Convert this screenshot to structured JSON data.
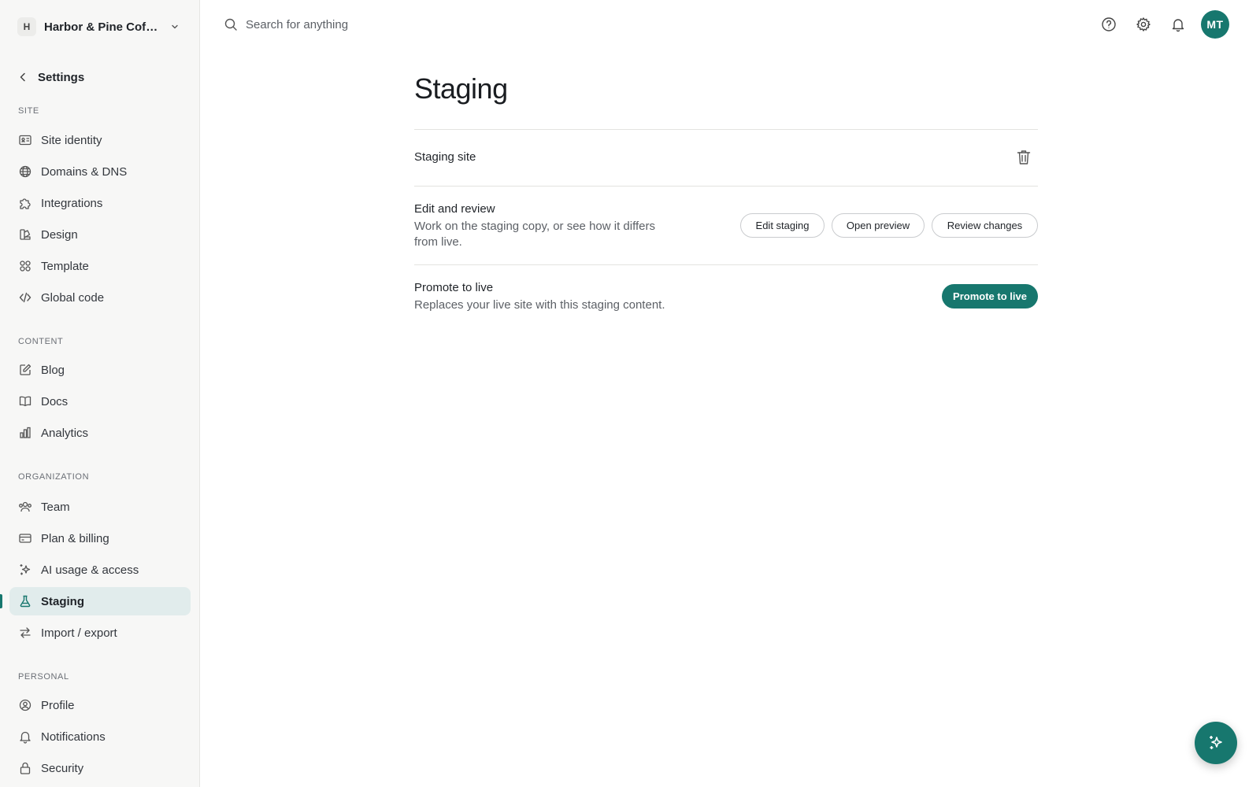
{
  "workspace": {
    "initial": "H",
    "name": "Harbor & Pine Coff…"
  },
  "sidebar": {
    "back_label": "Settings",
    "sections": [
      {
        "label": "SITE",
        "items": [
          {
            "label": "Site identity",
            "icon": "id-card-icon"
          },
          {
            "label": "Domains & DNS",
            "icon": "globe-icon"
          },
          {
            "label": "Integrations",
            "icon": "puzzle-icon"
          },
          {
            "label": "Design",
            "icon": "palette-icon"
          },
          {
            "label": "Template",
            "icon": "grid-icon"
          },
          {
            "label": "Global code",
            "icon": "code-icon"
          }
        ]
      },
      {
        "label": "CONTENT",
        "items": [
          {
            "label": "Blog",
            "icon": "edit-icon"
          },
          {
            "label": "Docs",
            "icon": "book-icon"
          },
          {
            "label": "Analytics",
            "icon": "bar-chart-icon"
          }
        ]
      },
      {
        "label": "ORGANIZATION",
        "items": [
          {
            "label": "Team",
            "icon": "users-icon"
          },
          {
            "label": "Plan & billing",
            "icon": "credit-card-icon"
          },
          {
            "label": "AI usage & access",
            "icon": "sparkles-icon"
          },
          {
            "label": "Staging",
            "icon": "flask-icon",
            "active": true
          },
          {
            "label": "Import / export",
            "icon": "arrows-icon"
          }
        ]
      },
      {
        "label": "PERSONAL",
        "items": [
          {
            "label": "Profile",
            "icon": "user-circle-icon"
          },
          {
            "label": "Notifications",
            "icon": "bell-icon"
          },
          {
            "label": "Security",
            "icon": "lock-icon"
          }
        ]
      }
    ]
  },
  "topbar": {
    "search_placeholder": "Search for anything",
    "avatar_initials": "MT"
  },
  "main": {
    "title": "Staging",
    "staging_site": {
      "title": "Staging site"
    },
    "edit_review": {
      "title": "Edit and review",
      "description_line1": "Work on the staging copy, or see how it differs",
      "description_line2": "from live.",
      "buttons": [
        "Edit staging",
        "Open preview",
        "Review changes"
      ]
    },
    "promote": {
      "title": "Promote to live",
      "description": "Replaces your live site with this staging content.",
      "button": "Promote to live"
    }
  },
  "colors": {
    "accent": "#17776e",
    "active_bg": "#e1ecec",
    "sidebar_bg": "#f7f7f6"
  }
}
